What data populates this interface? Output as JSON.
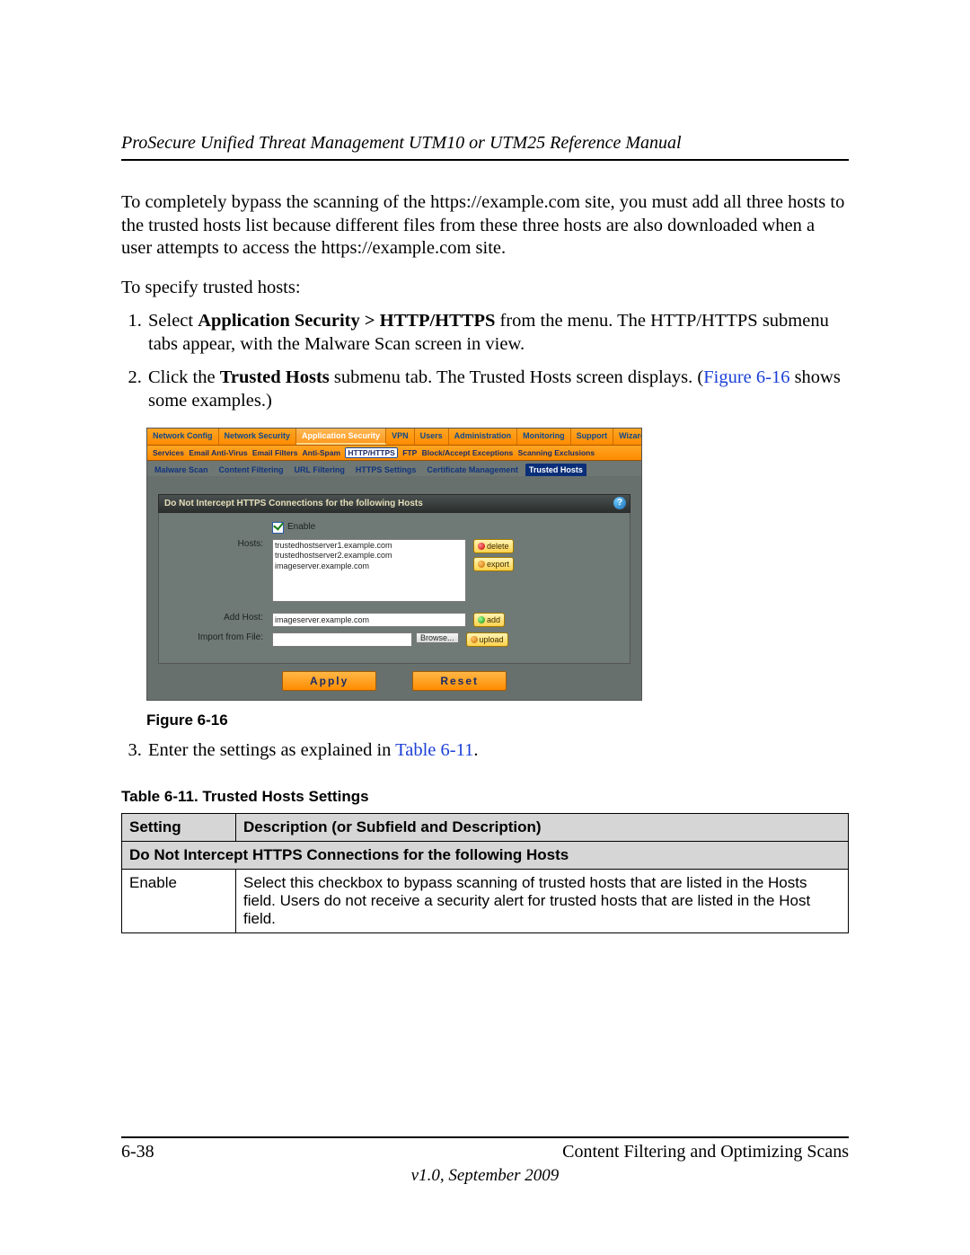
{
  "header": {
    "running_title": "ProSecure Unified Threat Management UTM10 or UTM25 Reference Manual"
  },
  "paragraphs": {
    "p1": "To completely bypass the scanning of the https://example.com site, you must add all three hosts to the trusted hosts list because different files from these three hosts are also downloaded when a user attempts to access the https://example.com site.",
    "p2": "To specify trusted hosts:"
  },
  "steps": {
    "s1_a": "Select ",
    "s1_b": "Application Security > HTTP/HTTPS",
    "s1_c": " from the menu. The HTTP/HTTPS submenu tabs appear, with the Malware Scan screen in view.",
    "s2_a": "Click the ",
    "s2_b": "Trusted Hosts",
    "s2_c": " submenu tab. The Trusted Hosts screen displays. (",
    "s2_link": "Figure 6-16",
    "s2_d": " shows some examples.)",
    "s3_a": "Enter the settings as explained in ",
    "s3_link": "Table 6-11",
    "s3_b": "."
  },
  "figure": {
    "caption": "Figure 6-16",
    "main_tabs": [
      "Network Config",
      "Network Security",
      "Application Security",
      "VPN",
      "Users",
      "Administration",
      "Monitoring",
      "Support",
      "Wizards"
    ],
    "main_active_index": 2,
    "services": [
      "Services",
      "Email Anti-Virus",
      "Email Filters",
      "Anti-Spam",
      "HTTP/HTTPS",
      "FTP",
      "Block/Accept Exceptions",
      "Scanning Exclusions"
    ],
    "services_active_index": 4,
    "subtabs": [
      "Malware Scan",
      "Content Filtering",
      "URL Filtering",
      "HTTPS Settings",
      "Certificate Management",
      "Trusted Hosts"
    ],
    "subtab_active_index": 5,
    "panel_title": "Do Not Intercept HTTPS Connections for the following Hosts",
    "enable_label": "Enable",
    "hosts_label": "Hosts:",
    "hosts_list": [
      "trustedhostserver1.example.com",
      "trustedhostserver2.example.com",
      "imageserver.example.com"
    ],
    "delete_label": "delete",
    "export_label": "export",
    "add_host_label": "Add Host:",
    "add_host_value": "imageserver.example.com",
    "add_label": "add",
    "import_label": "Import from File:",
    "browse_label": "Browse...",
    "upload_label": "upload",
    "apply_label": "Apply",
    "reset_label": "Reset"
  },
  "table": {
    "caption": "Table 6-11. Trusted Hosts Settings",
    "h_setting": "Setting",
    "h_desc": "Description (or Subfield and Description)",
    "section": "Do Not Intercept HTTPS Connections for the following Hosts",
    "rows": [
      {
        "setting": "Enable",
        "desc": "Select this checkbox to bypass scanning of trusted hosts that are listed in the Hosts field. Users do not receive a security alert for trusted hosts that are listed in the Host field."
      }
    ]
  },
  "footer": {
    "page_num": "6-38",
    "chapter": "Content Filtering and Optimizing Scans",
    "version": "v1.0, September 2009"
  }
}
